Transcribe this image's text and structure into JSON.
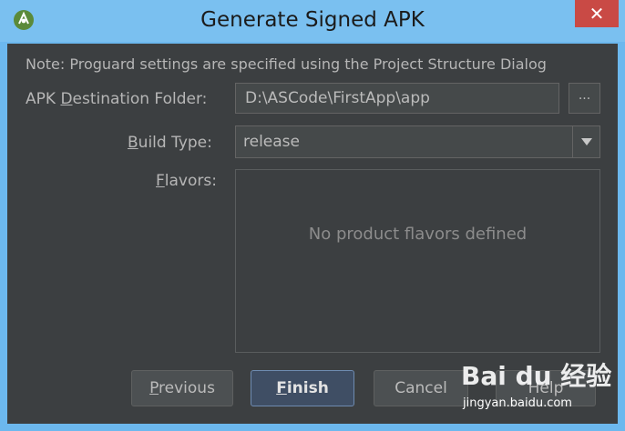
{
  "window": {
    "title": "Generate Signed APK",
    "close_label": "✕"
  },
  "note": "Note: Proguard settings are specified using the Project Structure Dialog",
  "destination": {
    "label_prefix": "APK ",
    "label_mnemonic": "D",
    "label_suffix": "estination Folder:",
    "value": "D:\\ASCode\\FirstApp\\app",
    "browse_label": "..."
  },
  "build_type": {
    "label_mnemonic": "B",
    "label_suffix": "uild Type:",
    "value": "release"
  },
  "flavors": {
    "label_mnemonic": "F",
    "label_suffix": "lavors:",
    "empty_text": "No product flavors defined"
  },
  "buttons": {
    "previous_mnemonic": "P",
    "previous_rest": "revious",
    "finish_mnemonic": "F",
    "finish_rest": "inish",
    "cancel": "Cancel",
    "help": "Help"
  },
  "watermark": {
    "logo": "Bai du 经验",
    "url": "jingyan.baidu.com"
  },
  "colors": {
    "titlebar": "#7ac0f0",
    "panel": "#3c3f41",
    "close_button": "#c94a45",
    "finish_border": "#6e8bb0"
  }
}
